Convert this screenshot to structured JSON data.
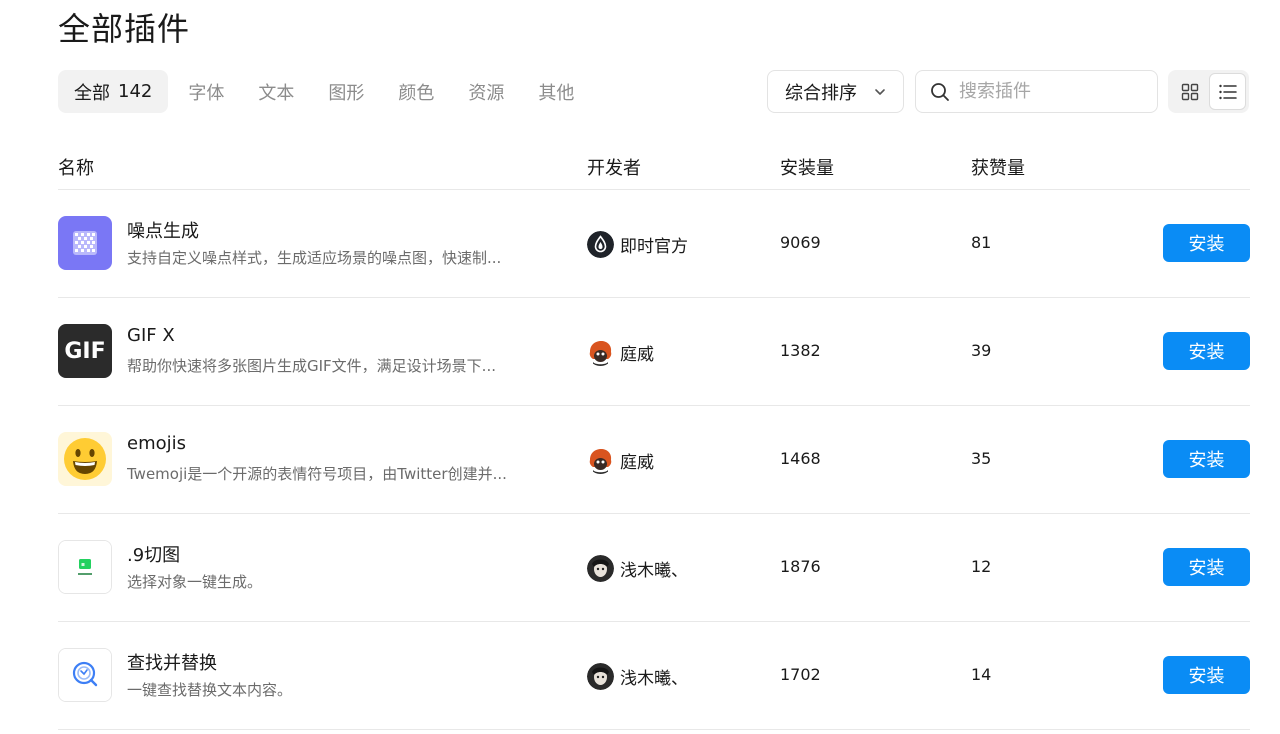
{
  "page": {
    "title": "全部插件"
  },
  "tabs": [
    {
      "label": "全部",
      "count": "142"
    },
    {
      "label": "字体"
    },
    {
      "label": "文本"
    },
    {
      "label": "图形"
    },
    {
      "label": "颜色"
    },
    {
      "label": "资源"
    },
    {
      "label": "其他"
    }
  ],
  "sort": {
    "label": "综合排序"
  },
  "search": {
    "placeholder": "搜索插件"
  },
  "table": {
    "columns": {
      "name": "名称",
      "developer": "开发者",
      "installs": "安装量",
      "likes": "获赞量"
    },
    "install_label": "安装",
    "rows": [
      {
        "name": "噪点生成",
        "desc": "支持自定义噪点样式，生成适应场景的噪点图，快速制...",
        "developer": "即时官方",
        "installs": "9069",
        "likes": "81",
        "icon": "noise-icon",
        "avatar": "jishi-logo"
      },
      {
        "name": "GIF X",
        "desc": "帮助你快速将多张图片生成GIF文件，满足设计场景下...",
        "developer": "庭威",
        "installs": "1382",
        "likes": "39",
        "icon": "gif-icon",
        "icon_text": "GIF",
        "avatar": "cartoon-avatar"
      },
      {
        "name": "emojis",
        "desc": "Twemoji是一个开源的表情符号项目，由Twitter创建并...",
        "developer": "庭威",
        "installs": "1468",
        "likes": "35",
        "icon": "smiley-icon",
        "avatar": "cartoon-avatar"
      },
      {
        "name": ".9切图",
        "desc": "选择对象一键生成。",
        "developer": "浅木曦、",
        "installs": "1876",
        "likes": "12",
        "icon": "nine-patch-icon",
        "avatar": "photo-avatar"
      },
      {
        "name": "查找并替换",
        "desc": "一键查找替换文本内容。",
        "developer": "浅木曦、",
        "installs": "1702",
        "likes": "14",
        "icon": "find-replace-icon",
        "avatar": "photo-avatar"
      }
    ]
  },
  "colors": {
    "primary": "#0a8cf5",
    "noise_icon_bg": "#7a77f5",
    "gif_icon_bg": "#2b2b2b",
    "emoji_icon_bg": "#fff6d8"
  }
}
